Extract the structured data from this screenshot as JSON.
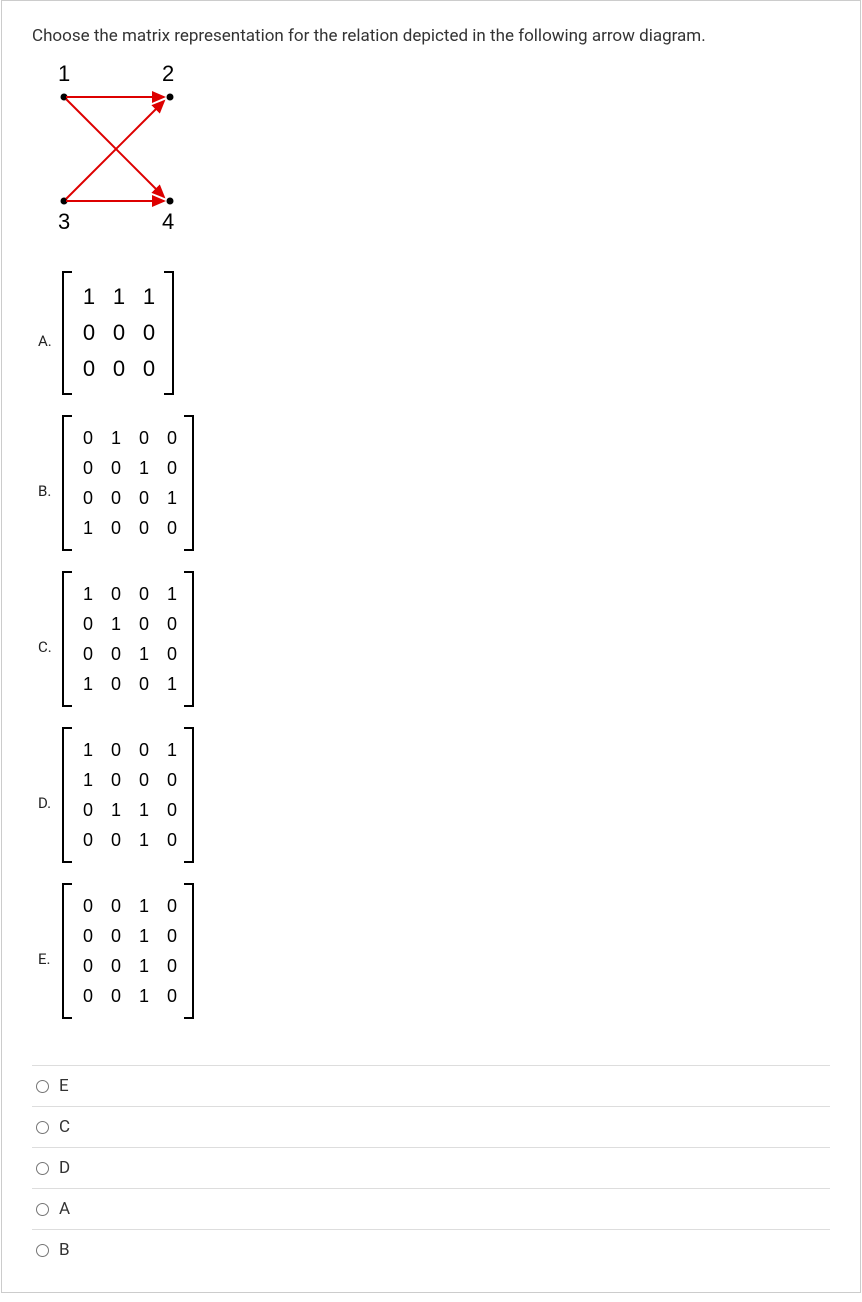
{
  "question": "Choose the matrix representation for the relation depicted in the following arrow diagram.",
  "diagram": {
    "labels": {
      "tl": "1",
      "tr": "2",
      "bl": "3",
      "br": "4"
    }
  },
  "options": [
    {
      "letter": "A.",
      "rows": [
        [
          "1",
          "1",
          "1"
        ],
        [
          "0",
          "0",
          "0"
        ],
        [
          "0",
          "0",
          "0"
        ]
      ]
    },
    {
      "letter": "B.",
      "rows": [
        [
          "0",
          "1",
          "0",
          "0"
        ],
        [
          "0",
          "0",
          "1",
          "0"
        ],
        [
          "0",
          "0",
          "0",
          "1"
        ],
        [
          "1",
          "0",
          "0",
          "0"
        ]
      ]
    },
    {
      "letter": "C.",
      "rows": [
        [
          "1",
          "0",
          "0",
          "1"
        ],
        [
          "0",
          "1",
          "0",
          "0"
        ],
        [
          "0",
          "0",
          "1",
          "0"
        ],
        [
          "1",
          "0",
          "0",
          "1"
        ]
      ]
    },
    {
      "letter": "D.",
      "rows": [
        [
          "1",
          "0",
          "0",
          "1"
        ],
        [
          "1",
          "0",
          "0",
          "0"
        ],
        [
          "0",
          "1",
          "1",
          "0"
        ],
        [
          "0",
          "0",
          "1",
          "0"
        ]
      ]
    },
    {
      "letter": "E.",
      "rows": [
        [
          "0",
          "0",
          "1",
          "0"
        ],
        [
          "0",
          "0",
          "1",
          "0"
        ],
        [
          "0",
          "0",
          "1",
          "0"
        ],
        [
          "0",
          "0",
          "1",
          "0"
        ]
      ]
    }
  ],
  "answers": [
    "E",
    "C",
    "D",
    "A",
    "B"
  ]
}
